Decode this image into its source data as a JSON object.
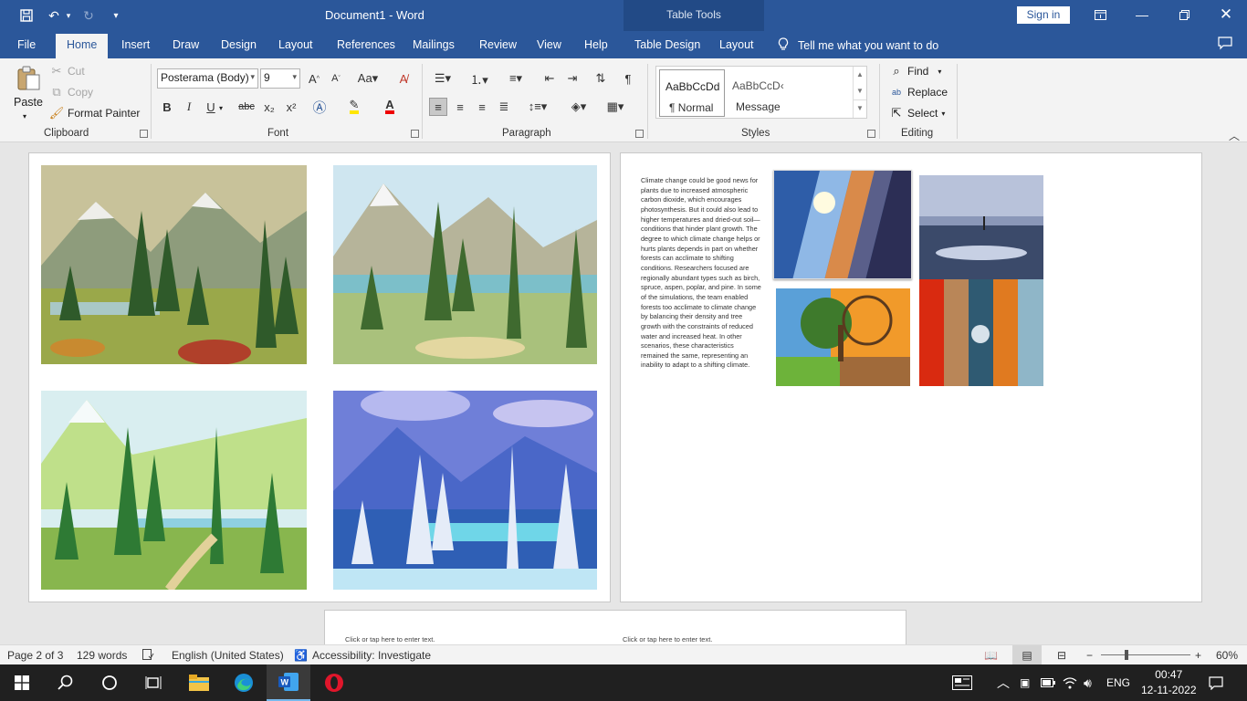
{
  "title_bar": {
    "document_title": "Document1  -  Word",
    "contextual_group": "Table Tools",
    "sign_in": "Sign in",
    "quick_access": [
      "save-icon",
      "undo-icon",
      "redo-icon",
      "customize-icon"
    ]
  },
  "tabs": [
    "File",
    "Home",
    "Insert",
    "Draw",
    "Design",
    "Layout",
    "References",
    "Mailings",
    "Review",
    "View",
    "Help",
    "Table Design",
    "Layout"
  ],
  "active_tab": "Home",
  "tell_me": "Tell me what you want to do",
  "clipboard": {
    "paste": "Paste",
    "cut": "Cut",
    "copy": "Copy",
    "format_painter": "Format Painter",
    "label": "Clipboard"
  },
  "font": {
    "name": "Posterama (Body)",
    "size": "9",
    "label": "Font",
    "buttons": [
      "B",
      "I",
      "U",
      "abc",
      "x₂",
      "x²"
    ]
  },
  "paragraph": {
    "label": "Paragraph"
  },
  "styles": {
    "tiles": [
      {
        "sample": "AaBbCcDd",
        "name": "¶ Normal"
      },
      {
        "sample": "AaBbCcD‹",
        "name": "Message"
      }
    ],
    "label": "Styles"
  },
  "editing": {
    "find": "Find",
    "replace": "Replace",
    "select": "Select",
    "label": "Editing"
  },
  "document": {
    "body_text": "Climate change could be good news for plants due to increased atmospheric carbon dioxide, which encourages photosynthesis. But it could also lead to higher temperatures and dried-out soil—conditions that hinder plant growth. The degree to which climate change helps or hurts plants depends in part on whether forests can acclimate to shifting conditions. Researchers focused are regionally abundant types such as birch, spruce, aspen, poplar, and pine. In some of the simulations, the team enabled forests too acclimate to climate change by balancing their density and tree growth with the constraints of reduced water and increased heat. In other scenarios, these characteristics remained the same, representing an inability to adapt to a shifting climate.",
    "placeholder_left": "Click or tap here to enter text.",
    "placeholder_right": "Click or tap here to enter text."
  },
  "status_bar": {
    "page": "Page 2 of 3",
    "words": "129 words",
    "language": "English (United States)",
    "accessibility": "Accessibility: Investigate",
    "zoom": "60%"
  },
  "taskbar": {
    "language": "ENG",
    "time": "00:47",
    "date": "12-11-2022"
  }
}
